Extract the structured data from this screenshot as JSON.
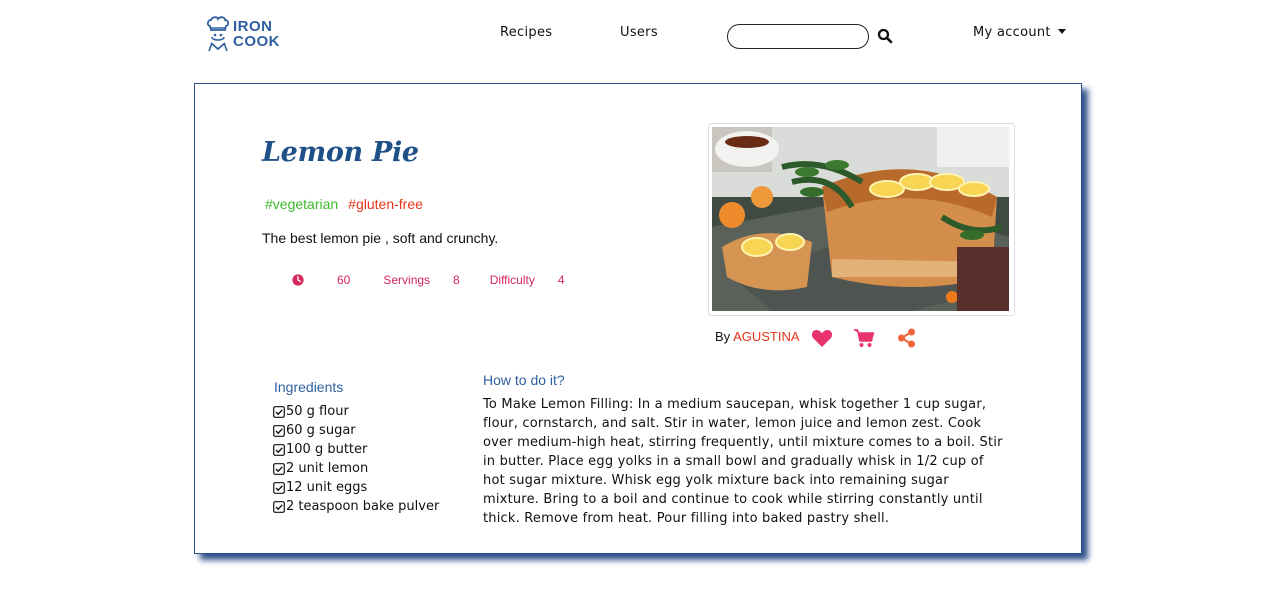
{
  "nav": {
    "logo_line1": "IRON",
    "logo_line2": "COOK",
    "links": [
      "Recipes",
      "Users"
    ],
    "search_placeholder": "",
    "account_label": "My account"
  },
  "recipe": {
    "title": "Lemon Pie",
    "tags": [
      "#vegetarian",
      "#gluten-free"
    ],
    "description": "The best lemon pie , soft and crunchy.",
    "time": "60",
    "servings_label": "Servings",
    "servings": "8",
    "difficulty_label": "Difficulty",
    "difficulty": "4",
    "by_label": "By",
    "author": "AGUSTINA",
    "ingredients_title": "Ingredients",
    "ingredients": [
      "50 g flour",
      "60 g sugar",
      "100 g butter",
      "2 unit lemon",
      "12 unit eggs",
      "2 teaspoon bake pulver"
    ],
    "howto_title": "How to do it?",
    "howto_text": "To Make Lemon Filling: In a medium saucepan, whisk together 1 cup sugar, flour, cornstarch, and salt. Stir in water, lemon juice and lemon zest. Cook over medium-high heat, stirring frequently, until mixture comes to a boil. Stir in butter. Place egg yolks in a small bowl and gradually whisk in 1/2 cup of hot sugar mixture. Whisk egg yolk mixture back into remaining sugar mixture. Bring to a boil and continue to cook while stirring constantly until thick. Remove from heat. Pour filling into baked pastry shell."
  },
  "colors": {
    "brand_blue": "#2f5fa0",
    "title_blue": "#1f5188",
    "accent_pink": "#d3285c",
    "tag_green": "#3db92c",
    "tag_red": "#e5361b",
    "icon_pink": "#e8336d",
    "icon_orange": "#f0643c"
  },
  "icons": {
    "logo": "chef-hat-icon",
    "search": "search-icon",
    "time": "clock-icon",
    "ingredient": "checkbox-icon",
    "favorite": "heart-icon",
    "cart": "cart-icon",
    "share": "share-icon"
  }
}
